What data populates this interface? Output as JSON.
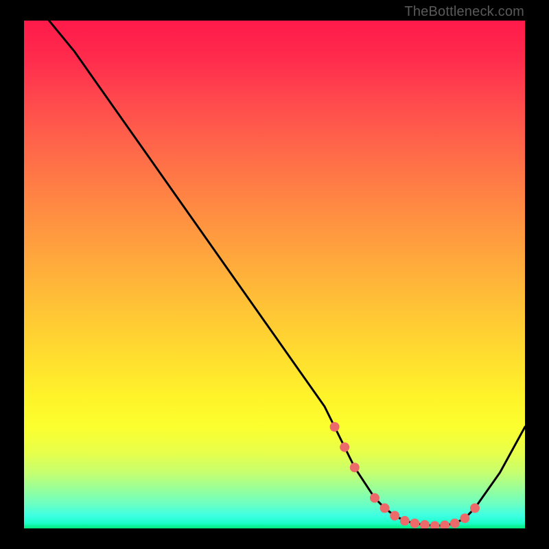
{
  "attribution": "TheBottleneck.com",
  "chart_data": {
    "type": "line",
    "title": "",
    "xlabel": "",
    "ylabel": "",
    "xlim": [
      0,
      100
    ],
    "ylim": [
      0,
      100
    ],
    "series": [
      {
        "name": "bottleneck-curve",
        "x": [
          5,
          10,
          15,
          20,
          25,
          30,
          35,
          40,
          45,
          50,
          55,
          60,
          62,
          64,
          66,
          68,
          70,
          72,
          74,
          76,
          78,
          80,
          82,
          84,
          86,
          88,
          90,
          95,
          100
        ],
        "y": [
          100,
          94,
          87,
          80,
          73,
          66,
          59,
          52,
          45,
          38,
          31,
          24,
          20,
          16,
          12,
          9,
          6,
          4,
          2.5,
          1.5,
          1,
          0.7,
          0.5,
          0.6,
          1,
          2,
          4,
          11,
          20
        ]
      }
    ],
    "markers": {
      "name": "highlight-dots",
      "x": [
        62,
        64,
        66,
        70,
        72,
        74,
        76,
        78,
        80,
        82,
        84,
        86,
        88,
        90
      ],
      "y": [
        20,
        16,
        12,
        6,
        4,
        2.5,
        1.5,
        1,
        0.7,
        0.5,
        0.6,
        1,
        2,
        4
      ]
    },
    "colors": {
      "curve": "#000000",
      "markers": "#ec6a6a",
      "gradient_top": "#ff1a4a",
      "gradient_bottom": "#00e878"
    }
  }
}
